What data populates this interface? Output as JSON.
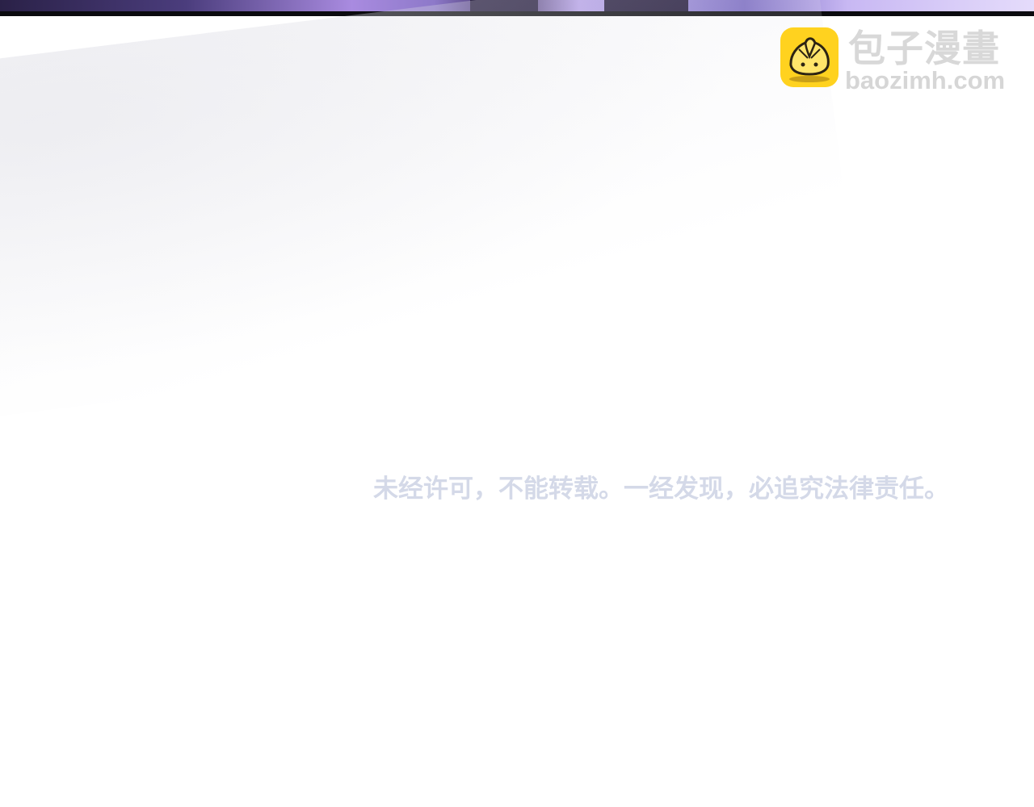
{
  "watermark": {
    "logo_chinese": "包子漫畫",
    "logo_domain": "baozimh.com",
    "icon_name": "steamed-bun-icon",
    "icon_color": "#ffd21f"
  },
  "copyright_notice": "未经许可，不能转载。一经发现，必追究法律责任。",
  "colors": {
    "background": "#ffffff",
    "top_border": "#0b0b0f",
    "notice_text": "#d4d9e8",
    "logo_text": "#d8d8d8",
    "artwork_purple": "#a98be0"
  }
}
